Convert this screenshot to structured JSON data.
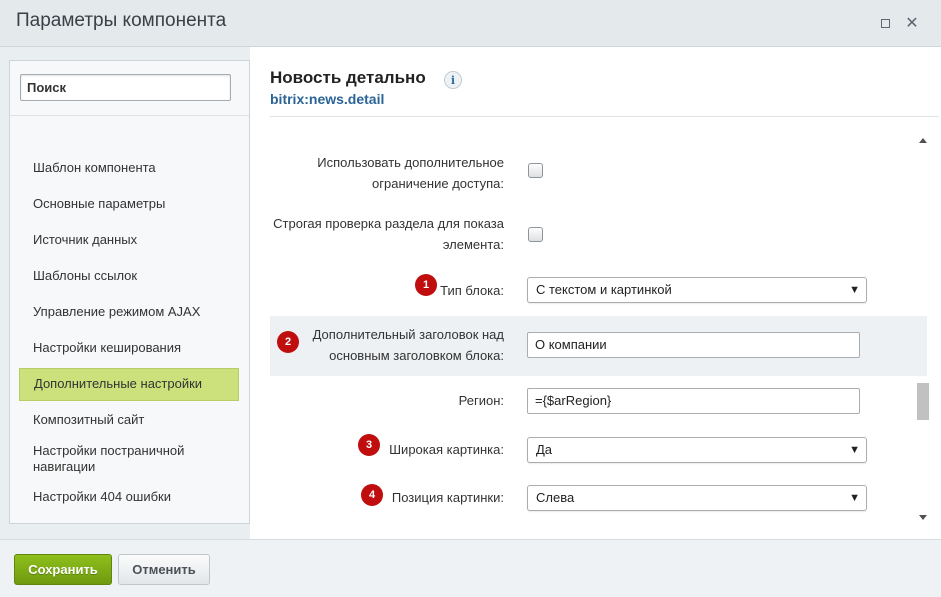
{
  "window": {
    "title": "Параметры компонента"
  },
  "sidebar": {
    "search_placeholder": "Поиск",
    "items": [
      {
        "label": "Шаблон компонента"
      },
      {
        "label": "Основные параметры"
      },
      {
        "label": "Источник данных"
      },
      {
        "label": "Шаблоны ссылок"
      },
      {
        "label": "Управление режимом AJAX"
      },
      {
        "label": "Настройки кеширования"
      },
      {
        "label": "Дополнительные настройки",
        "active": true
      },
      {
        "label": "Композитный сайт"
      },
      {
        "label": "Настройки постраничной навигации"
      },
      {
        "label": "Настройки 404 ошибки"
      }
    ]
  },
  "component": {
    "name": "Новость детально",
    "code": "bitrix:news.detail",
    "info_glyph": "i"
  },
  "params": {
    "extra_access": {
      "label_line1": "Использовать дополнительное",
      "label_line2": "ограничение доступа:"
    },
    "strict_check": {
      "label_line1": "Строгая проверка раздела для показа",
      "label_line2": "элемента:"
    },
    "block_type": {
      "badge": "1",
      "label": "Тип блока:",
      "value": "С текстом и картинкой"
    },
    "extra_heading": {
      "badge": "2",
      "label_line1": "Дополнительный заголовок над",
      "label_line2": "основным заголовком блока:",
      "value": "О компании"
    },
    "region": {
      "label": "Регион:",
      "value": "={$arRegion}"
    },
    "wide_image": {
      "badge": "3",
      "label": "Широкая картинка:",
      "value": "Да"
    },
    "image_position": {
      "badge": "4",
      "label": "Позиция картинки:",
      "value": "Слева"
    }
  },
  "footer": {
    "save_label": "Сохранить",
    "cancel_label": "Отменить"
  }
}
